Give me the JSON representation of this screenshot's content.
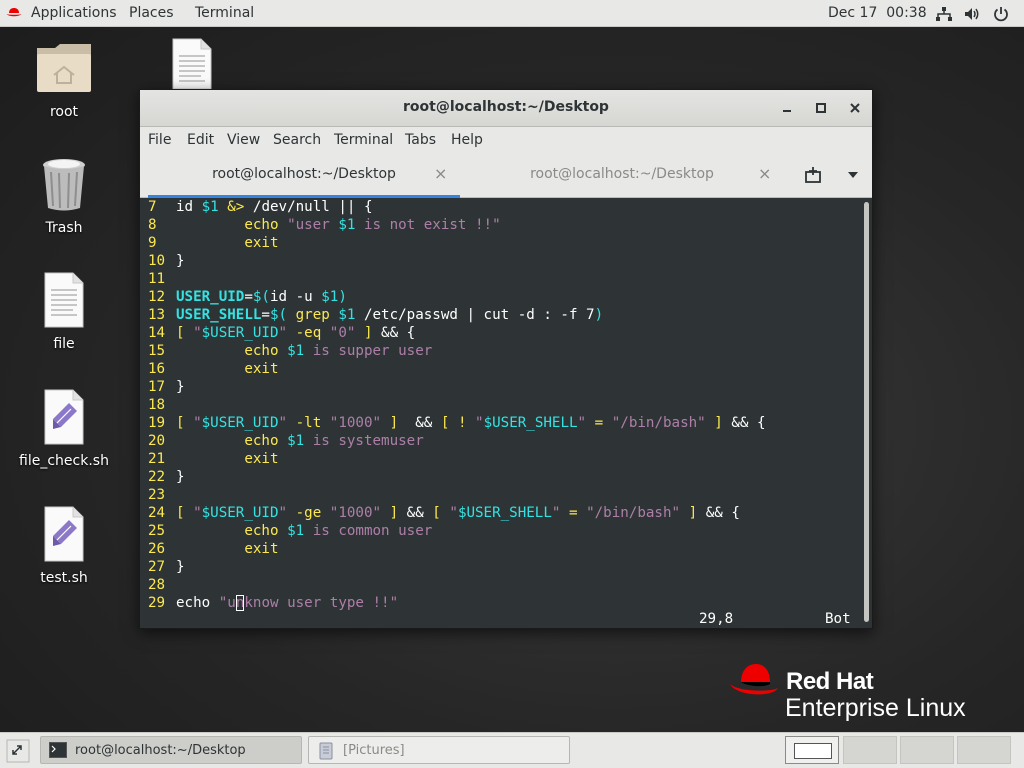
{
  "topbar": {
    "applications": "Applications",
    "places": "Places",
    "terminal": "Terminal",
    "datetime": "Dec 17  00:38",
    "icons": [
      "network-icon",
      "volume-icon",
      "power-icon"
    ]
  },
  "desktop": {
    "icons": [
      {
        "label": "root",
        "icon": "home-folder-icon"
      },
      {
        "label": "Trash",
        "icon": "trash-icon"
      },
      {
        "label": "file",
        "icon": "text-file-icon"
      },
      {
        "label": "file_check.sh",
        "icon": "script-file-icon"
      },
      {
        "label": "test.sh",
        "icon": "script-file-icon"
      },
      {
        "label": "",
        "icon": "text-file-icon"
      }
    ]
  },
  "window": {
    "title": "root@localhost:~/Desktop",
    "menu": [
      "File",
      "Edit",
      "View",
      "Search",
      "Terminal",
      "Tabs",
      "Help"
    ],
    "tabs": [
      {
        "label": "root@localhost:~/Desktop",
        "active": true
      },
      {
        "label": "root@localhost:~/Desktop",
        "active": false
      }
    ],
    "close_symbol": "×",
    "status_position": "29,8",
    "status_scroll": "Bot"
  },
  "code_lines": [
    {
      "n": "7",
      "text": "id $1 &> /dev/null || {"
    },
    {
      "n": "8",
      "text": "        echo \"user $1 is not exist !!\""
    },
    {
      "n": "9",
      "text": "        exit"
    },
    {
      "n": "10",
      "text": "}"
    },
    {
      "n": "11",
      "text": ""
    },
    {
      "n": "12",
      "text": "USER_UID=$(id -u $1)"
    },
    {
      "n": "13",
      "text": "USER_SHELL=$( grep $1 /etc/passwd | cut -d : -f 7)"
    },
    {
      "n": "14",
      "text": "[ \"$USER_UID\" -eq \"0\" ] && {"
    },
    {
      "n": "15",
      "text": "        echo $1 is supper user"
    },
    {
      "n": "16",
      "text": "        exit"
    },
    {
      "n": "17",
      "text": "}"
    },
    {
      "n": "18",
      "text": ""
    },
    {
      "n": "19",
      "text": "[ \"$USER_UID\" -lt \"1000\" ]  && [ ! \"$USER_SHELL\" = \"/bin/bash\" ] && {"
    },
    {
      "n": "20",
      "text": "        echo $1 is systemuser"
    },
    {
      "n": "21",
      "text": "        exit"
    },
    {
      "n": "22",
      "text": "}"
    },
    {
      "n": "23",
      "text": ""
    },
    {
      "n": "24",
      "text": "[ \"$USER_UID\" -ge \"1000\" ] && [ \"$USER_SHELL\" = \"/bin/bash\" ] && {"
    },
    {
      "n": "25",
      "text": "        echo $1 is common user"
    },
    {
      "n": "26",
      "text": "        exit"
    },
    {
      "n": "27",
      "text": "}"
    },
    {
      "n": "28",
      "text": ""
    },
    {
      "n": "29",
      "text": "echo \"unknow user type !!\""
    }
  ],
  "branding": {
    "line1": "Red Hat",
    "line2": "Enterprise Linux"
  },
  "taskbar": {
    "items": [
      {
        "label": "root@localhost:~/Desktop",
        "icon": "terminal-icon"
      },
      {
        "label": "[Pictures]",
        "icon": "file-manager-icon"
      }
    ],
    "workspaces": 4
  },
  "colors": {
    "terminal_bg": "#2e3436",
    "line_number": "#fce94f",
    "keyword": "#fce94f",
    "variable": "#34e2e2",
    "string": "#ad7fa8",
    "redhat_red": "#ee0000",
    "tab_accent": "#3584e4"
  }
}
